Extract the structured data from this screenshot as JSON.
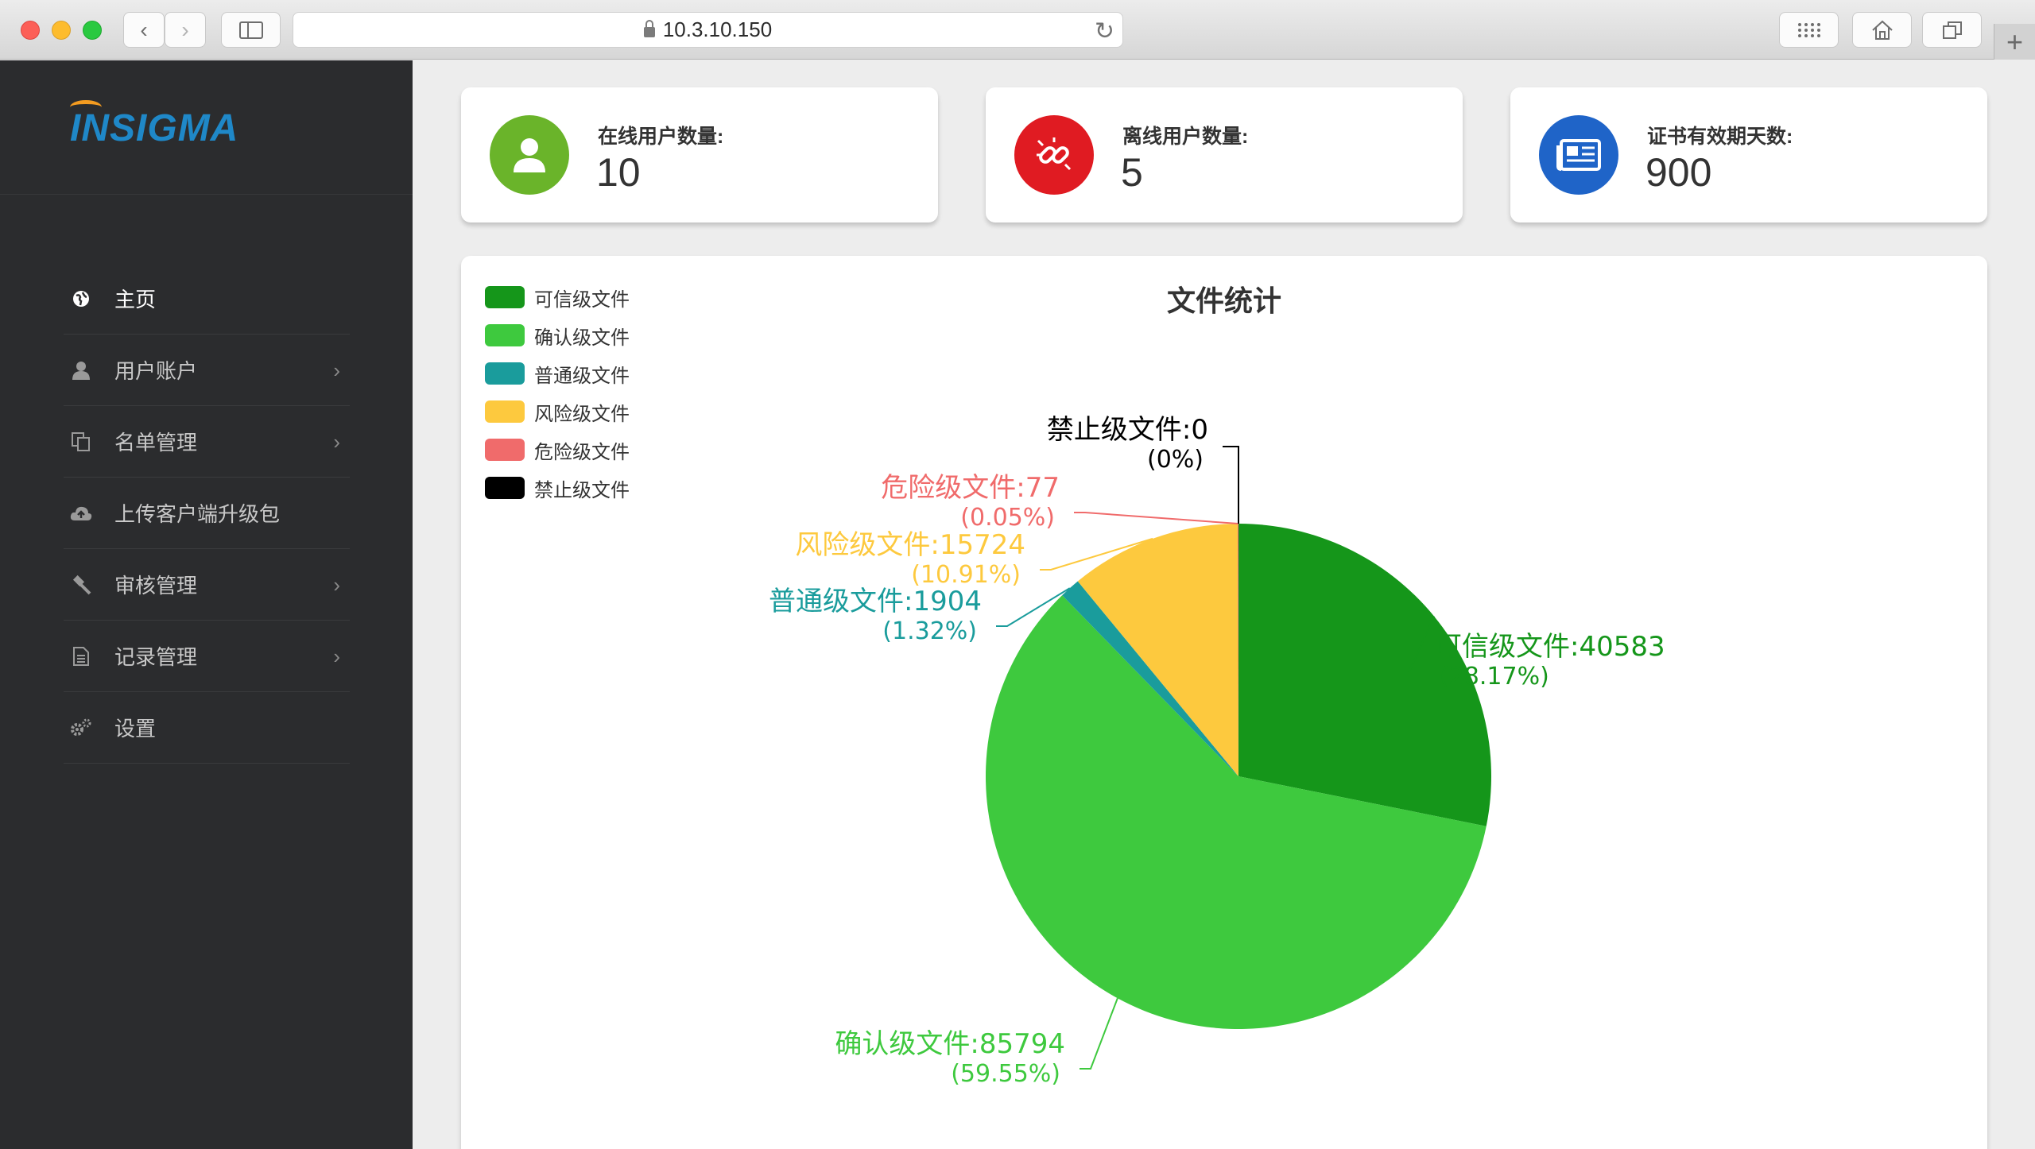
{
  "browser": {
    "address": "10.3.10.150"
  },
  "sidebar": {
    "logo_text": "INSIGMA",
    "items": [
      {
        "label": "主页",
        "icon": "globe-icon",
        "active": true,
        "has_arrow": false
      },
      {
        "label": "用户账户",
        "icon": "user-icon",
        "active": false,
        "has_arrow": true
      },
      {
        "label": "名单管理",
        "icon": "copy-icon",
        "active": false,
        "has_arrow": true
      },
      {
        "label": "上传客户端升级包",
        "icon": "cloud-upload-icon",
        "active": false,
        "has_arrow": false
      },
      {
        "label": "审核管理",
        "icon": "gavel-icon",
        "active": false,
        "has_arrow": true
      },
      {
        "label": "记录管理",
        "icon": "file-icon",
        "active": false,
        "has_arrow": true
      },
      {
        "label": "设置",
        "icon": "gears-icon",
        "active": false,
        "has_arrow": false
      }
    ]
  },
  "stats": [
    {
      "label": "在线用户数量:",
      "value": "10",
      "color": "#6ab42a",
      "icon": "user-icon"
    },
    {
      "label": "离线用户数量:",
      "value": "5",
      "color": "#e01b22",
      "icon": "broken-link-icon"
    },
    {
      "label": "证书有效期天数:",
      "value": "900",
      "color": "#1f64c8",
      "icon": "newspaper-icon"
    }
  ],
  "chart_data": {
    "type": "pie",
    "title": "文件统计",
    "legend_position": "top-left",
    "slices": [
      {
        "name": "可信级文件",
        "value": 40583,
        "percent": "28.17%",
        "color": "#15961a"
      },
      {
        "name": "确认级文件",
        "value": 85794,
        "percent": "59.55%",
        "color": "#3ec93e"
      },
      {
        "name": "普通级文件",
        "value": 1904,
        "percent": "1.32%",
        "color": "#1a9c9c"
      },
      {
        "name": "风险级文件",
        "value": 15724,
        "percent": "10.91%",
        "color": "#fdc93e"
      },
      {
        "name": "危险级文件",
        "value": 77,
        "percent": "0.05%",
        "color": "#f06b6b"
      },
      {
        "name": "禁止级文件",
        "value": 0,
        "percent": "0%",
        "color": "#000000"
      }
    ]
  }
}
